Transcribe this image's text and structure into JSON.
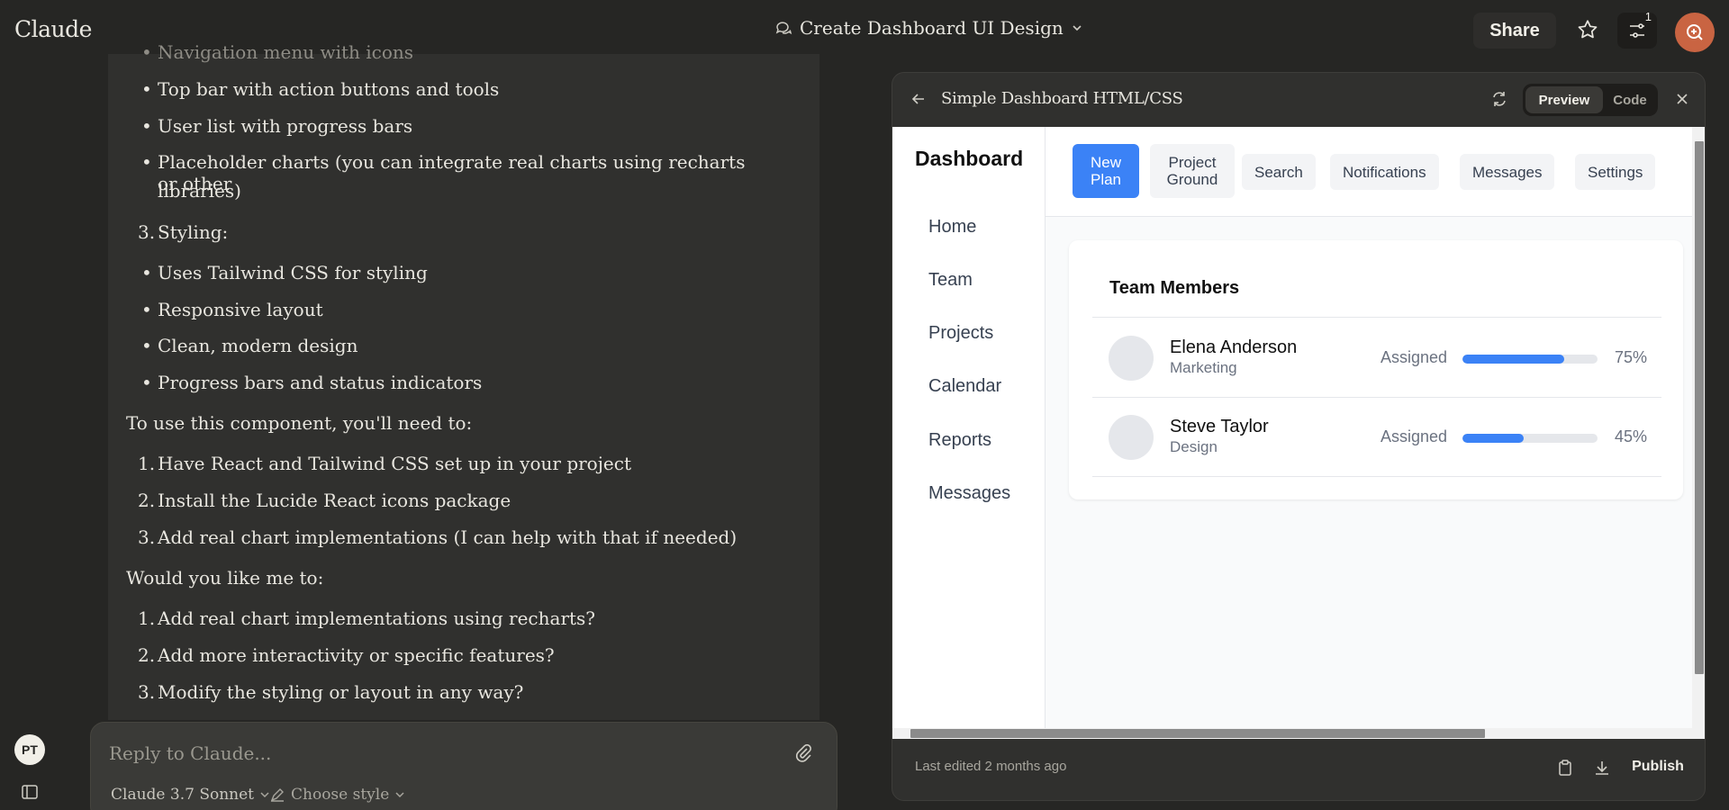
{
  "app": {
    "brand": "Claude",
    "conversation_title": "Create Dashboard UI Design",
    "share_label": "Share",
    "settings_badge": "1",
    "user_initials": "PT",
    "accent_color": "#c96442"
  },
  "chat": {
    "items": [
      {
        "type": "bullet",
        "text": "Navigation menu with icons",
        "faded": true
      },
      {
        "type": "bullet",
        "text": "Top bar with action buttons and tools"
      },
      {
        "type": "bullet",
        "text": "User list with progress bars"
      },
      {
        "type": "bullet",
        "text": "Placeholder charts (you can integrate real charts using recharts or other"
      },
      {
        "type": "cont",
        "text": "libraries)"
      },
      {
        "type": "num",
        "num": "3.",
        "text": "Styling:"
      },
      {
        "type": "bullet",
        "text": "Uses Tailwind CSS for styling"
      },
      {
        "type": "bullet",
        "text": "Responsive layout"
      },
      {
        "type": "bullet",
        "text": "Clean, modern design"
      },
      {
        "type": "bullet",
        "text": "Progress bars and status indicators"
      },
      {
        "type": "para",
        "text": "To use this component, you'll need to:"
      },
      {
        "type": "num",
        "num": "1.",
        "text": "Have React and Tailwind CSS set up in your project"
      },
      {
        "type": "num",
        "num": "2.",
        "text": "Install the Lucide React icons package"
      },
      {
        "type": "num",
        "num": "3.",
        "text": "Add real chart implementations (I can help with that if needed)"
      },
      {
        "type": "para",
        "text": "Would you like me to:"
      },
      {
        "type": "num",
        "num": "1.",
        "text": "Add real chart implementations using recharts?"
      },
      {
        "type": "num",
        "num": "2.",
        "text": "Add more interactivity or specific features?"
      },
      {
        "type": "num",
        "num": "3.",
        "text": "Modify the styling or layout in any way?"
      }
    ]
  },
  "composer": {
    "placeholder": "Reply to Claude...",
    "model": "Claude 3.7 Sonnet",
    "style": "Choose style"
  },
  "artifact": {
    "title": "Simple Dashboard HTML/CSS",
    "tabs": {
      "preview": "Preview",
      "code": "Code"
    },
    "last_edited": "Last edited 2 months ago",
    "publish_label": "Publish"
  },
  "dashboard": {
    "title": "Dashboard",
    "nav": [
      "Home",
      "Team",
      "Projects",
      "Calendar",
      "Reports",
      "Messages"
    ],
    "toolbar": {
      "new_plan": [
        "New",
        "Plan"
      ],
      "project_ground": [
        "Project",
        "Ground"
      ],
      "search": "Search",
      "notifications": "Notifications",
      "messages": "Messages",
      "settings": "Settings"
    },
    "card_title": "Team Members",
    "members": [
      {
        "name": "Elena Anderson",
        "department": "Marketing",
        "status": "Assigned",
        "progress": 75,
        "progress_label": "75%"
      },
      {
        "name": "Steve Taylor",
        "department": "Design",
        "status": "Assigned",
        "progress": 45,
        "progress_label": "45%"
      }
    ],
    "primary_color": "#3b82f6"
  }
}
